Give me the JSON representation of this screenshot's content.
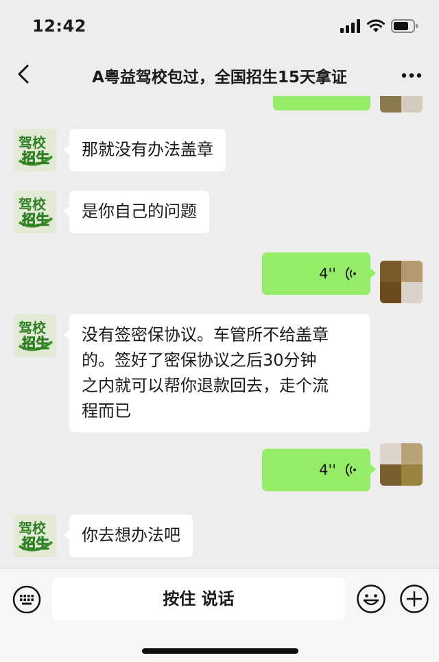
{
  "status_bar": {
    "time": "12:42"
  },
  "header": {
    "title": "A粤益驾校包过，全国招生15天拿证"
  },
  "bot_avatar": {
    "line1": "驾校",
    "line2": "招生"
  },
  "messages": [
    {
      "sender": "contact",
      "type": "text",
      "text": "那就没有办法盖章"
    },
    {
      "sender": "contact",
      "type": "text",
      "text": "是你自己的问题"
    },
    {
      "sender": "me",
      "type": "voice",
      "duration": "4''"
    },
    {
      "sender": "contact",
      "type": "text",
      "lines": [
        "没有签密保协议。车管所不给盖章",
        "的。签好了密保协议之后30分钟",
        "之内就可以帮你退款回去，走个流",
        "程而已"
      ]
    },
    {
      "sender": "me",
      "type": "voice",
      "duration": "4''"
    },
    {
      "sender": "contact",
      "type": "text",
      "text": "你去想办法吧"
    }
  ],
  "input_bar": {
    "hold_to_talk_label": "按住 说话"
  },
  "colors": {
    "background": "#ededed",
    "outgoing_bubble": "#95ec69",
    "incoming_bubble": "#ffffff"
  },
  "icons": [
    "back-icon",
    "more-icon",
    "signal-icon",
    "wifi-icon",
    "battery-icon",
    "voice-wave-icon",
    "keyboard-icon",
    "emoji-icon",
    "plus-icon"
  ]
}
